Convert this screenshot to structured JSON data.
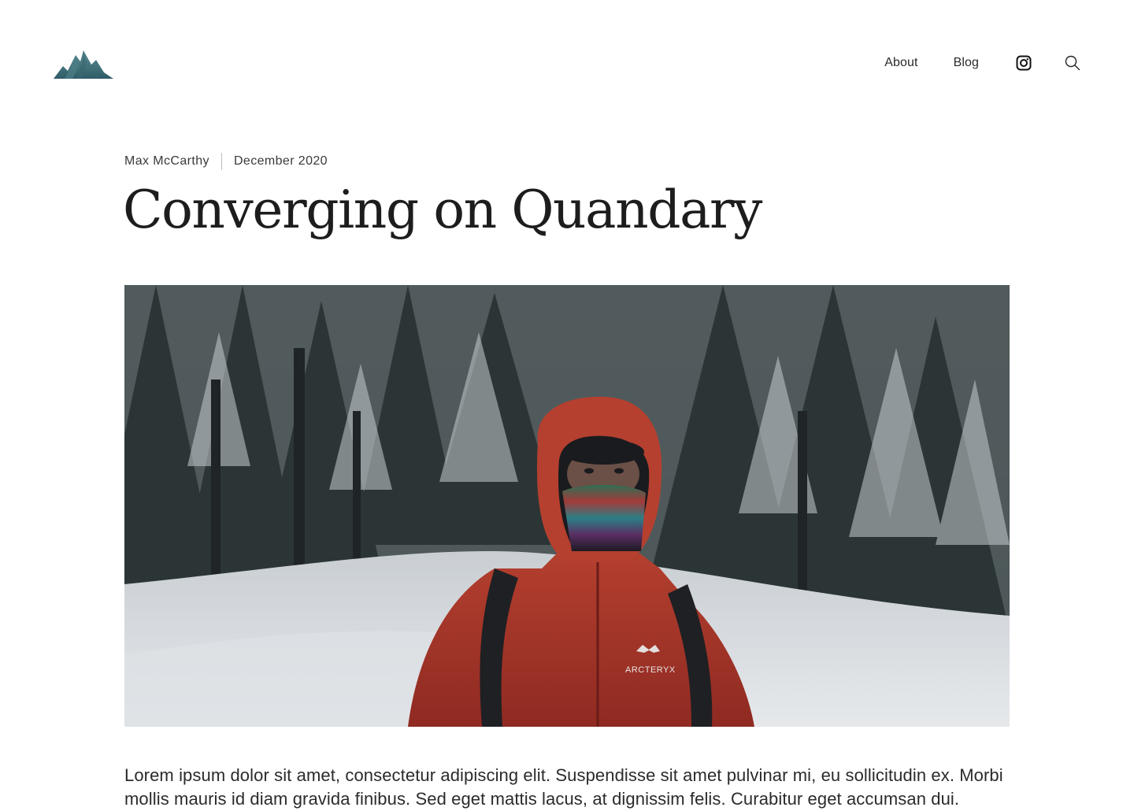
{
  "header": {
    "logo_icon": "mountain-logo-icon",
    "nav": {
      "about_label": "About",
      "blog_label": "Blog",
      "instagram_icon": "instagram-icon",
      "search_icon": "search-icon"
    }
  },
  "article": {
    "author": "Max McCarthy",
    "date": "December 2020",
    "title": "Converging on Quandary",
    "hero_image_text": "ARCTERYX",
    "body_text": "Lorem ipsum dolor sit amet, consectetur adipiscing elit. Suspendisse sit amet pulvinar mi, eu sollicitudin ex. Morbi mollis mauris id diam gravida finibus. Sed eget mattis lacus, at dignissim felis. Curabitur eget accumsan dui."
  },
  "colors": {
    "logo_teal": "#3f6f78",
    "jacket_red": "#b33a2f"
  }
}
